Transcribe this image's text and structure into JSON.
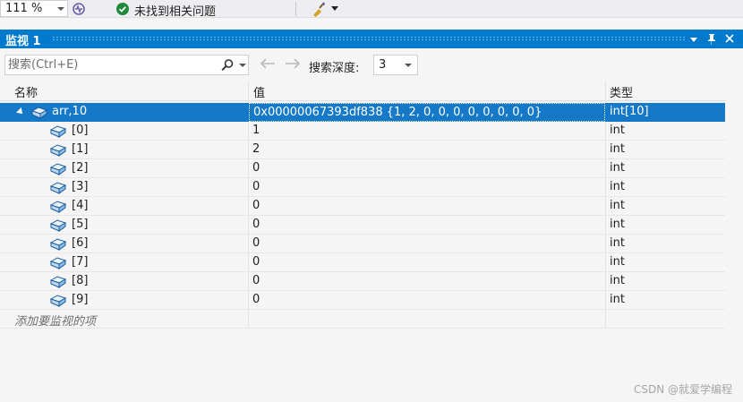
{
  "toolbar": {
    "zoom": "111 %",
    "status": "未找到相关问题"
  },
  "watch": {
    "title": "监视 1",
    "search_placeholder": "搜索(Ctrl+E)",
    "depth_label": "搜索深度:",
    "depth_value": "3",
    "columns": {
      "name": "名称",
      "value": "值",
      "type": "类型"
    },
    "root": {
      "name": "arr,10",
      "value": "0x00000067393df838 {1, 2, 0, 0, 0, 0, 0, 0, 0, 0}",
      "type": "int[10]"
    },
    "children": [
      {
        "name": "[0]",
        "value": "1",
        "type": "int"
      },
      {
        "name": "[1]",
        "value": "2",
        "type": "int"
      },
      {
        "name": "[2]",
        "value": "0",
        "type": "int"
      },
      {
        "name": "[3]",
        "value": "0",
        "type": "int"
      },
      {
        "name": "[4]",
        "value": "0",
        "type": "int"
      },
      {
        "name": "[5]",
        "value": "0",
        "type": "int"
      },
      {
        "name": "[6]",
        "value": "0",
        "type": "int"
      },
      {
        "name": "[7]",
        "value": "0",
        "type": "int"
      },
      {
        "name": "[8]",
        "value": "0",
        "type": "int"
      },
      {
        "name": "[9]",
        "value": "0",
        "type": "int"
      }
    ],
    "add_hint": "添加要监视的项"
  },
  "watermark": "CSDN @就爱学编程",
  "colors": {
    "accent": "#007acc",
    "selection": "#1679c7"
  }
}
